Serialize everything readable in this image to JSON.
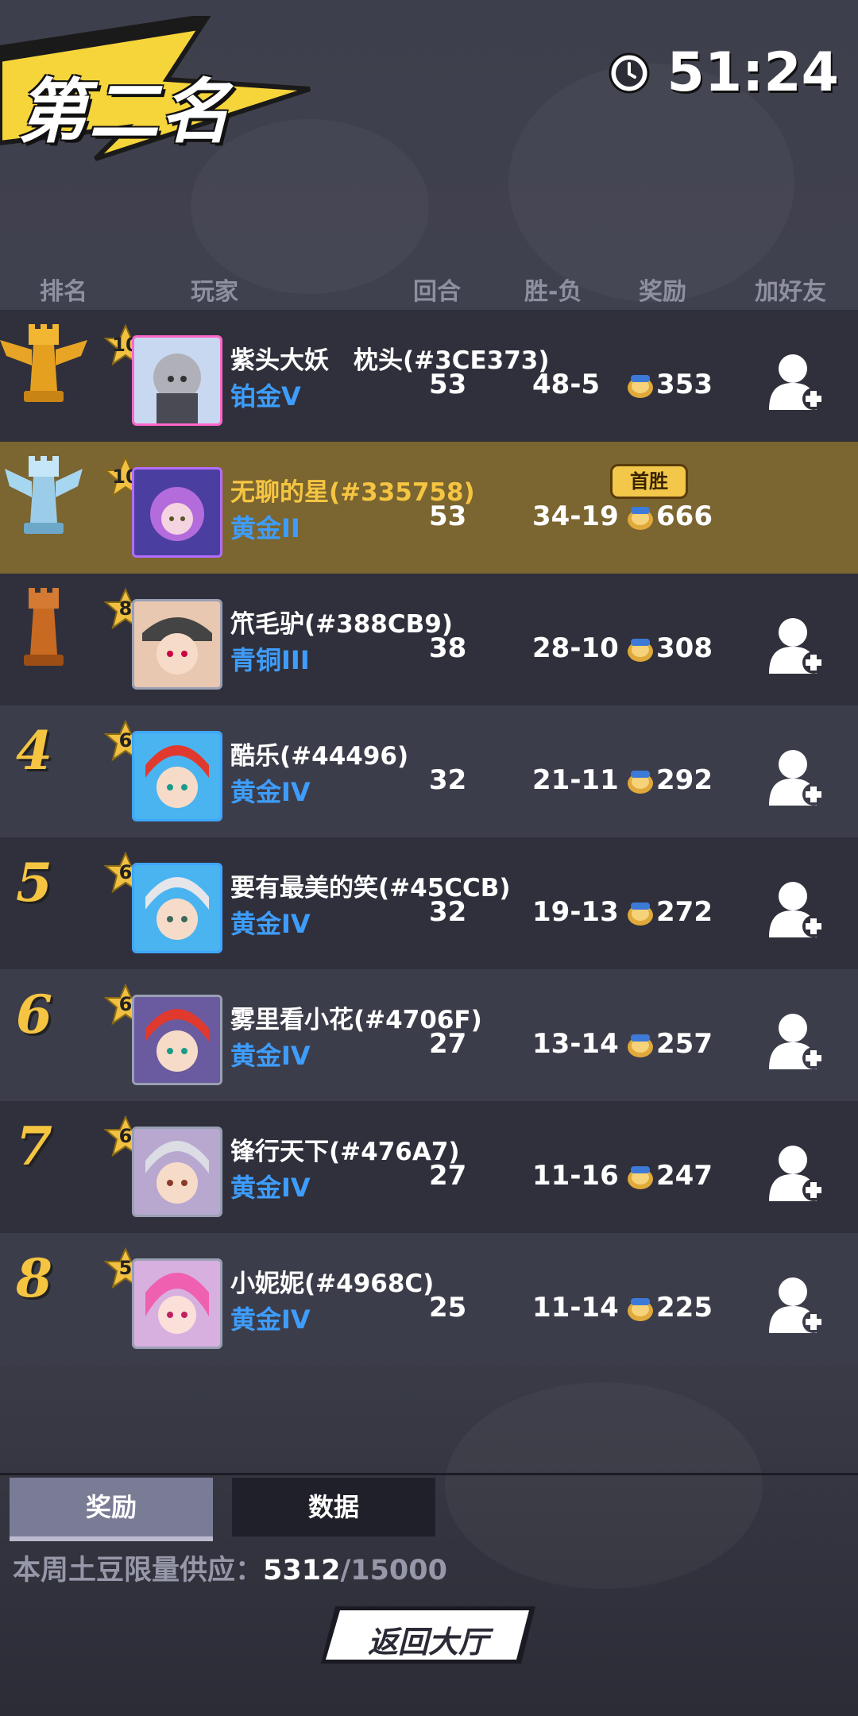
{
  "header": {
    "placement_title": "第二名",
    "timer": "51:24"
  },
  "columns": {
    "rank": "排名",
    "player": "玩家",
    "rounds": "回合",
    "win_loss": "胜-负",
    "reward": "奖励",
    "add_friend": "加好友"
  },
  "first_win_badge": "首胜",
  "players": [
    {
      "rank": "1",
      "level": "10",
      "name": "紫头大妖　枕头(#3CE373)",
      "tier": "铂金V",
      "rounds": "53",
      "wl": "48-5",
      "reward": "353"
    },
    {
      "rank": "2",
      "level": "10",
      "name": "无聊的星(#335758)",
      "tier": "黄金II",
      "rounds": "53",
      "wl": "34-19",
      "reward": "666"
    },
    {
      "rank": "3",
      "level": "8",
      "name": "笊毛驴(#388CB9)",
      "tier": "青铜III",
      "rounds": "38",
      "wl": "28-10",
      "reward": "308"
    },
    {
      "rank": "4",
      "level": "6",
      "name": "酷乐(#44496)",
      "tier": "黄金IV",
      "rounds": "32",
      "wl": "21-11",
      "reward": "292"
    },
    {
      "rank": "5",
      "level": "6",
      "name": "要有最美的笑(#45CCB)",
      "tier": "黄金IV",
      "rounds": "32",
      "wl": "19-13",
      "reward": "272"
    },
    {
      "rank": "6",
      "level": "6",
      "name": "雾里看小花(#4706F)",
      "tier": "黄金IV",
      "rounds": "27",
      "wl": "13-14",
      "reward": "257"
    },
    {
      "rank": "7",
      "level": "6",
      "name": "锋行天下(#476A7)",
      "tier": "黄金IV",
      "rounds": "27",
      "wl": "11-16",
      "reward": "247"
    },
    {
      "rank": "8",
      "level": "5",
      "name": "小妮妮(#4968C)",
      "tier": "黄金IV",
      "rounds": "25",
      "wl": "11-14",
      "reward": "225"
    }
  ],
  "tabs": {
    "reward": "奖励",
    "data": "数据"
  },
  "supply": {
    "label": "本周土豆限量供应：",
    "current": "5312",
    "max": "/15000"
  },
  "return_button": "返回大厅",
  "colors": {
    "highlight_row": "#7b6530",
    "tier_blue": "#3e9dfc",
    "gold": "#f5c542"
  }
}
